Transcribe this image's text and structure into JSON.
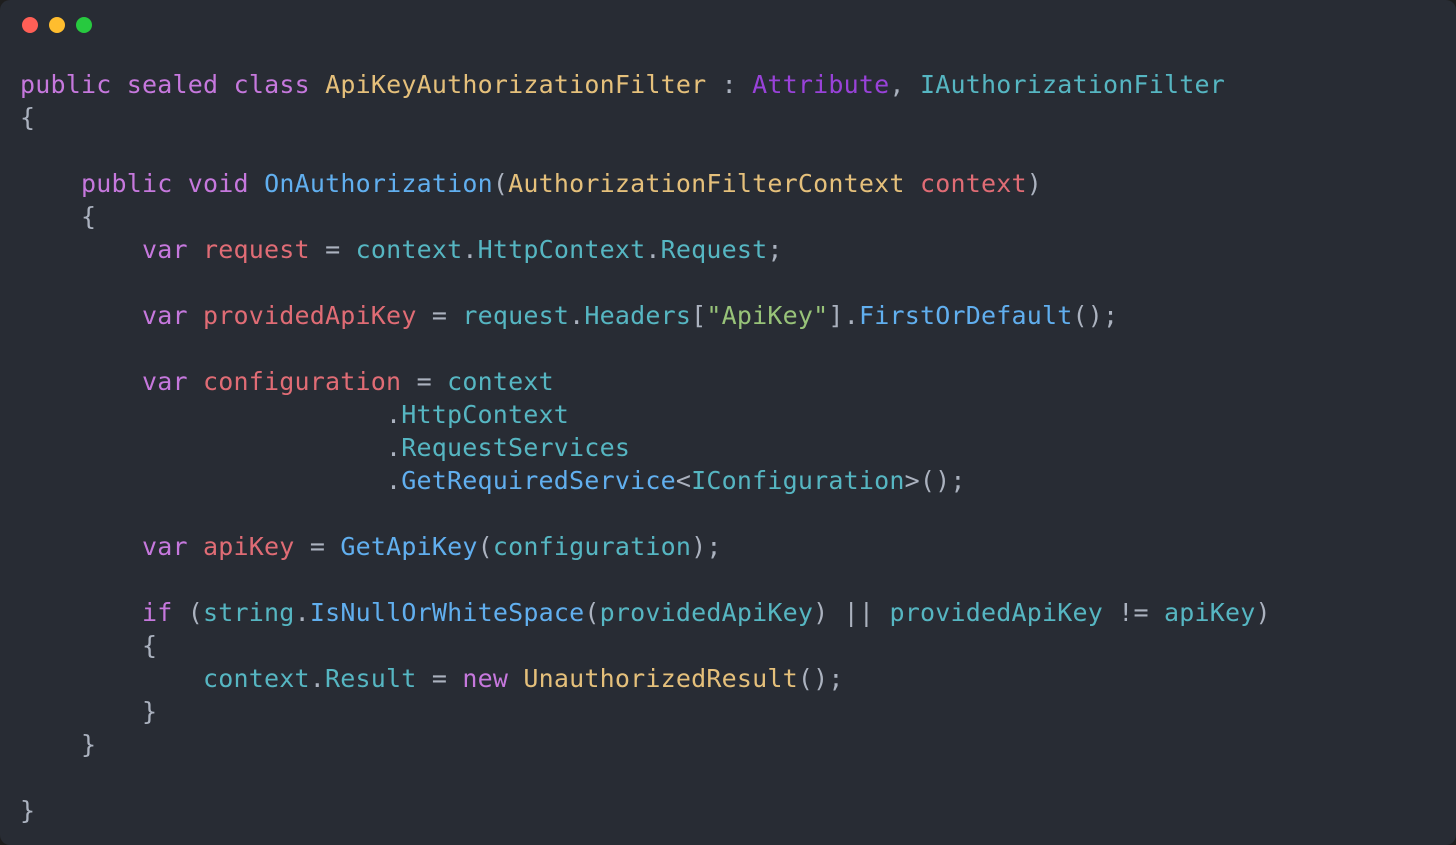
{
  "traffic_lights": [
    "red",
    "yellow",
    "green"
  ],
  "code": {
    "l1_public": "public",
    "l1_sealed": "sealed",
    "l1_class": "class",
    "l1_classname": "ApiKeyAuthorizationFilter",
    "l1_colon": " : ",
    "l1_base": "Attribute",
    "l1_comma": ", ",
    "l1_iface": "IAuthorizationFilter",
    "l2_brace": "{",
    "l4_public": "public",
    "l4_void": "void",
    "l4_method": "OnAuthorization",
    "l4_lparen": "(",
    "l4_paramtype": "AuthorizationFilterContext",
    "l4_paramname": "context",
    "l4_rparen": ")",
    "l5_brace": "{",
    "l6_var": "var",
    "l6_name": "request",
    "l6_eq": " = ",
    "l6_ctx": "context",
    "l6_dot1": ".",
    "l6_http": "HttpContext",
    "l6_dot2": ".",
    "l6_req": "Request",
    "l6_semi": ";",
    "l8_var": "var",
    "l8_name": "providedApiKey",
    "l8_eq": " = ",
    "l8_req": "request",
    "l8_dot1": ".",
    "l8_headers": "Headers",
    "l8_lbrack": "[",
    "l8_str": "\"ApiKey\"",
    "l8_rbrack": "]",
    "l8_dot2": ".",
    "l8_first": "FirstOrDefault",
    "l8_call": "();",
    "l10_var": "var",
    "l10_name": "configuration",
    "l10_eq": " = ",
    "l10_ctx": "context",
    "l11_dot": ".",
    "l11_http": "HttpContext",
    "l12_dot": ".",
    "l12_rs": "RequestServices",
    "l13_dot": ".",
    "l13_grs": "GetRequiredService",
    "l13_lt": "<",
    "l13_iconf": "IConfiguration",
    "l13_gt": ">",
    "l13_call": "();",
    "l15_var": "var",
    "l15_name": "apiKey",
    "l15_eq": " = ",
    "l15_method": "GetApiKey",
    "l15_lparen": "(",
    "l15_arg": "configuration",
    "l15_rparen": ");",
    "l17_if": "if",
    "l17_lparen": " (",
    "l17_string": "string",
    "l17_dot": ".",
    "l17_isnull": "IsNullOrWhiteSpace",
    "l17_lparen2": "(",
    "l17_arg1": "providedApiKey",
    "l17_rparen2": ")",
    "l17_or": " || ",
    "l17_arg2": "providedApiKey",
    "l17_neq": " != ",
    "l17_arg3": "apiKey",
    "l17_rparen": ")",
    "l18_brace": "{",
    "l19_ctx": "context",
    "l19_dot": ".",
    "l19_result": "Result",
    "l19_eq": " = ",
    "l19_new": "new",
    "l19_type": "UnauthorizedResult",
    "l19_call": "();",
    "l20_brace": "}",
    "l21_brace": "}",
    "l23_brace": "}"
  }
}
